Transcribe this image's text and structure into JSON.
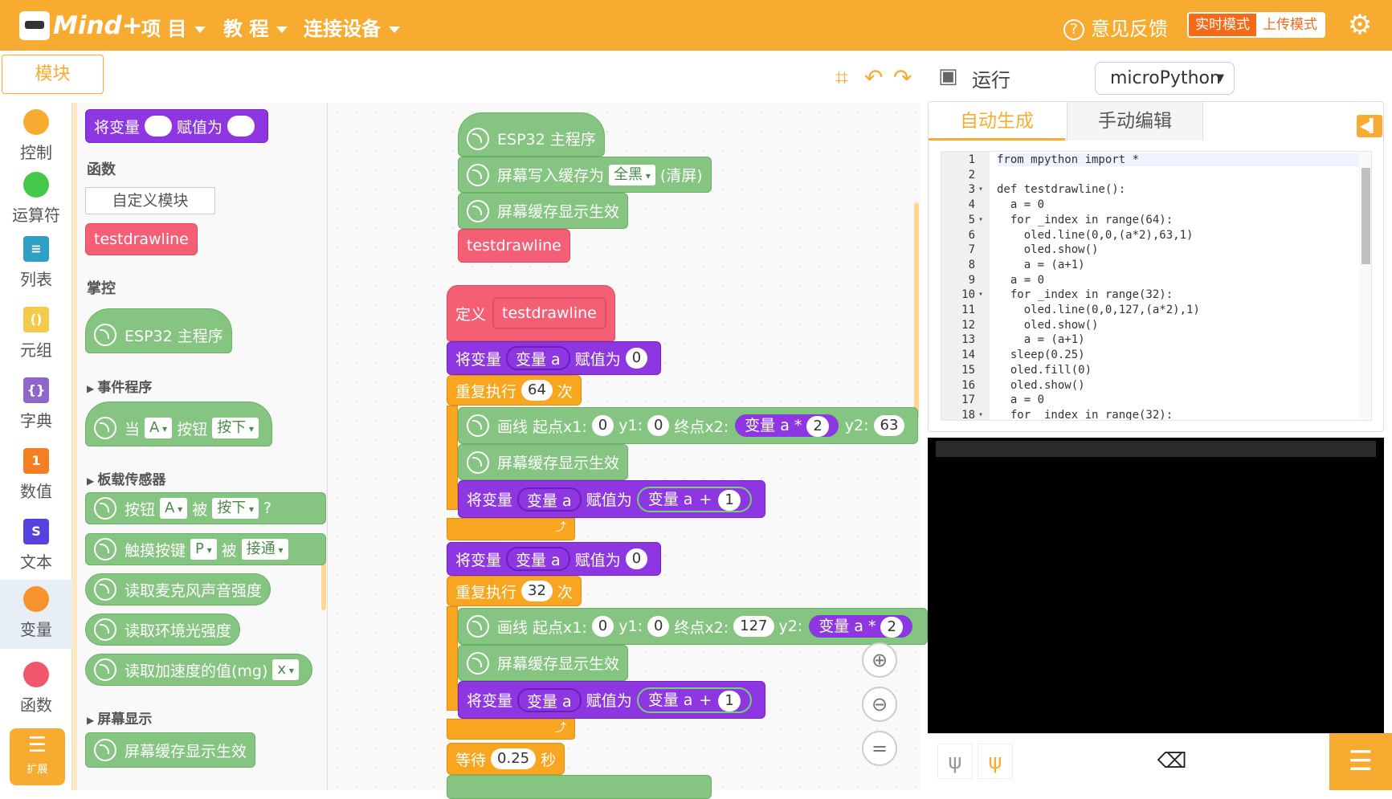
{
  "app": {
    "logo": "Mind+",
    "menus": [
      "项 目",
      "教 程",
      "连接设备"
    ],
    "feedback": "意见反馈",
    "mode_realtime": "实时模式",
    "mode_upload": "上传模式"
  },
  "toolbar": {
    "module_tab": "模块",
    "run": "运行",
    "language": "microPython"
  },
  "categories": [
    {
      "label": "控制",
      "color": "#f7ac31"
    },
    {
      "label": "运算符",
      "color": "#45c84a"
    },
    {
      "label": "列表",
      "color": "#2fa0c4"
    },
    {
      "label": "元组",
      "color": "#f5c94a"
    },
    {
      "label": "字典",
      "color": "#8e68c9"
    },
    {
      "label": "数值",
      "color": "#f57e20"
    },
    {
      "label": "文本",
      "color": "#5540e0"
    },
    {
      "label": "变量",
      "color": "#f7932a"
    },
    {
      "label": "函数",
      "color": "#f2566c"
    }
  ],
  "extend": "扩展",
  "palette": {
    "setvar": {
      "a": "将变量",
      "b": "赋值为"
    },
    "sec_func": "函数",
    "custom_block": "自定义模块",
    "testdrawline": "testdrawline",
    "sec_ctrl": "掌控",
    "esp32": "ESP32 主程序",
    "sec_event": "事件程序",
    "when": {
      "a": "当",
      "dd1": "A",
      "b": "按钮",
      "dd2": "按下"
    },
    "sec_sensor": "板载传感器",
    "btn": {
      "a": "按钮",
      "dd1": "A",
      "b": "被",
      "dd2": "按下",
      "q": "?"
    },
    "touch": {
      "a": "触摸按键",
      "dd1": "P",
      "b": "被",
      "dd2": "接通"
    },
    "mic": "读取麦克风声音强度",
    "light": "读取环境光强度",
    "accel": {
      "a": "读取加速度的值(mg)",
      "dd": "x"
    },
    "sec_screen": "屏幕显示",
    "show": "屏幕缓存显示生效"
  },
  "canvas": {
    "esp32": "ESP32 主程序",
    "fill": {
      "a": "屏幕写入缓存为",
      "dd": "全黑",
      "b": "(清屏)"
    },
    "show": "屏幕缓存显示生效",
    "call": "testdrawline",
    "define": {
      "a": "定义",
      "b": "testdrawline"
    },
    "setvar": {
      "a": "将变量",
      "v": "变量 a",
      "b": "赋值为",
      "val": "0"
    },
    "repeat1": {
      "a": "重复执行",
      "n": "64",
      "b": "次"
    },
    "line1": {
      "a": "画线 起点x1:",
      "x1": "0",
      "y1l": "y1:",
      "y1": "0",
      "x2l": "终点x2:",
      "v": "变量 a",
      "op": "*",
      "m": "2",
      "y2l": "y2:",
      "y2": "63"
    },
    "inc": {
      "a": "将变量",
      "v": "变量 a",
      "b": "赋值为",
      "v2": "变量 a",
      "op": "+",
      "n": "1"
    },
    "repeat2": {
      "a": "重复执行",
      "n": "32",
      "b": "次"
    },
    "line2": {
      "a": "画线 起点x1:",
      "x1": "0",
      "y1l": "y1:",
      "y1": "0",
      "x2l": "终点x2:",
      "x2": "127",
      "y2l": "y2:",
      "v": "变量 a",
      "op": "*",
      "m": "2"
    },
    "wait": {
      "a": "等待",
      "n": "0.25",
      "b": "秒"
    },
    "zoom": [
      "⊕",
      "⊖",
      "="
    ]
  },
  "code_panel": {
    "tab_auto": "自动生成",
    "tab_manual": "手动编辑",
    "lines": [
      {
        "n": "1",
        "fold": "",
        "t": "from mpython import *"
      },
      {
        "n": "2",
        "fold": "",
        "t": ""
      },
      {
        "n": "3",
        "fold": "▾",
        "t": "def testdrawline():"
      },
      {
        "n": "4",
        "fold": "",
        "t": "  a = 0"
      },
      {
        "n": "5",
        "fold": "▾",
        "t": "  for _index in range(64):"
      },
      {
        "n": "6",
        "fold": "",
        "t": "    oled.line(0,0,(a*2),63,1)"
      },
      {
        "n": "7",
        "fold": "",
        "t": "    oled.show()"
      },
      {
        "n": "8",
        "fold": "",
        "t": "    a = (a+1)"
      },
      {
        "n": "9",
        "fold": "",
        "t": "  a = 0"
      },
      {
        "n": "10",
        "fold": "▾",
        "t": "  for _index in range(32):"
      },
      {
        "n": "11",
        "fold": "",
        "t": "    oled.line(0,0,127,(a*2),1)"
      },
      {
        "n": "12",
        "fold": "",
        "t": "    oled.show()"
      },
      {
        "n": "13",
        "fold": "",
        "t": "    a = (a+1)"
      },
      {
        "n": "14",
        "fold": "",
        "t": "  sleep(0.25)"
      },
      {
        "n": "15",
        "fold": "",
        "t": "  oled.fill(0)"
      },
      {
        "n": "16",
        "fold": "",
        "t": "  oled.show()"
      },
      {
        "n": "17",
        "fold": "",
        "t": "  a = 0"
      },
      {
        "n": "18",
        "fold": "▾",
        "t": "  for _index in range(32):"
      }
    ]
  }
}
